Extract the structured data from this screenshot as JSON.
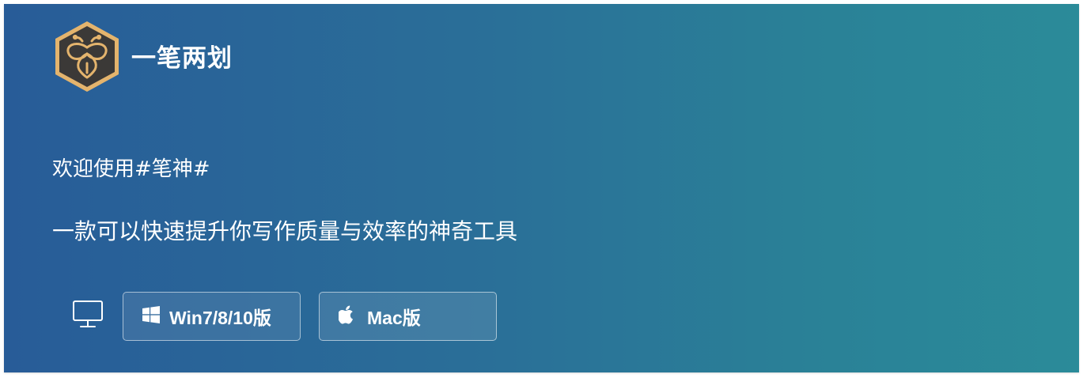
{
  "brand": {
    "name": "一笔两划",
    "logo_icon": "bee-pen-hexagon-logo",
    "logo_colors": {
      "hex_border": "#e4b46d",
      "hex_fill": "#3b3937",
      "glyph": "#e4b46d"
    }
  },
  "hero": {
    "welcome": "欢迎使用#笔神#",
    "tagline": "一款可以快速提升你写作质量与效率的神奇工具"
  },
  "download": {
    "platform_icon": "monitor-icon",
    "buttons": [
      {
        "label": "Win7/8/10版",
        "icon": "windows-icon"
      },
      {
        "label": "Mac版",
        "icon": "apple-icon"
      }
    ]
  },
  "colors": {
    "banner_gradient_start": "#285c98",
    "banner_gradient_end": "#2b8b99",
    "text": "#ffffff"
  }
}
